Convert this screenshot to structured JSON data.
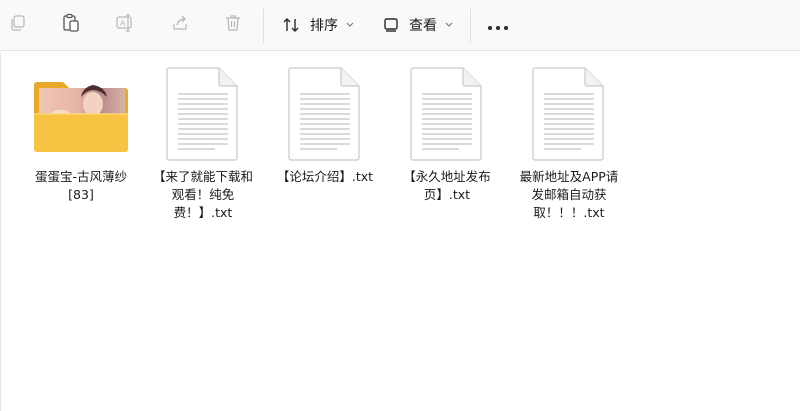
{
  "toolbar": {
    "sort_label": "排序",
    "view_label": "查看",
    "icons": [
      "copy-icon",
      "paste-icon",
      "rename-icon",
      "share-icon",
      "delete-icon",
      "sort-icon",
      "view-icon",
      "more-icon"
    ]
  },
  "items": [
    {
      "type": "folder",
      "label": "蛋蛋宝-古风薄纱[83]"
    },
    {
      "type": "txt",
      "label": "【来了就能下载和观看！纯免费！】.txt"
    },
    {
      "type": "txt",
      "label": "【论坛介绍】.txt"
    },
    {
      "type": "txt",
      "label": "【永久地址发布页】.txt"
    },
    {
      "type": "txt",
      "label": "最新地址及APP请发邮箱自动获取！！！.txt"
    }
  ],
  "colors": {
    "toolbar_bg": "#f9f9f9",
    "folder_yellow": "#f8c342",
    "folder_back": "#e9a825",
    "icon_disabled": "#b9b9b9"
  }
}
